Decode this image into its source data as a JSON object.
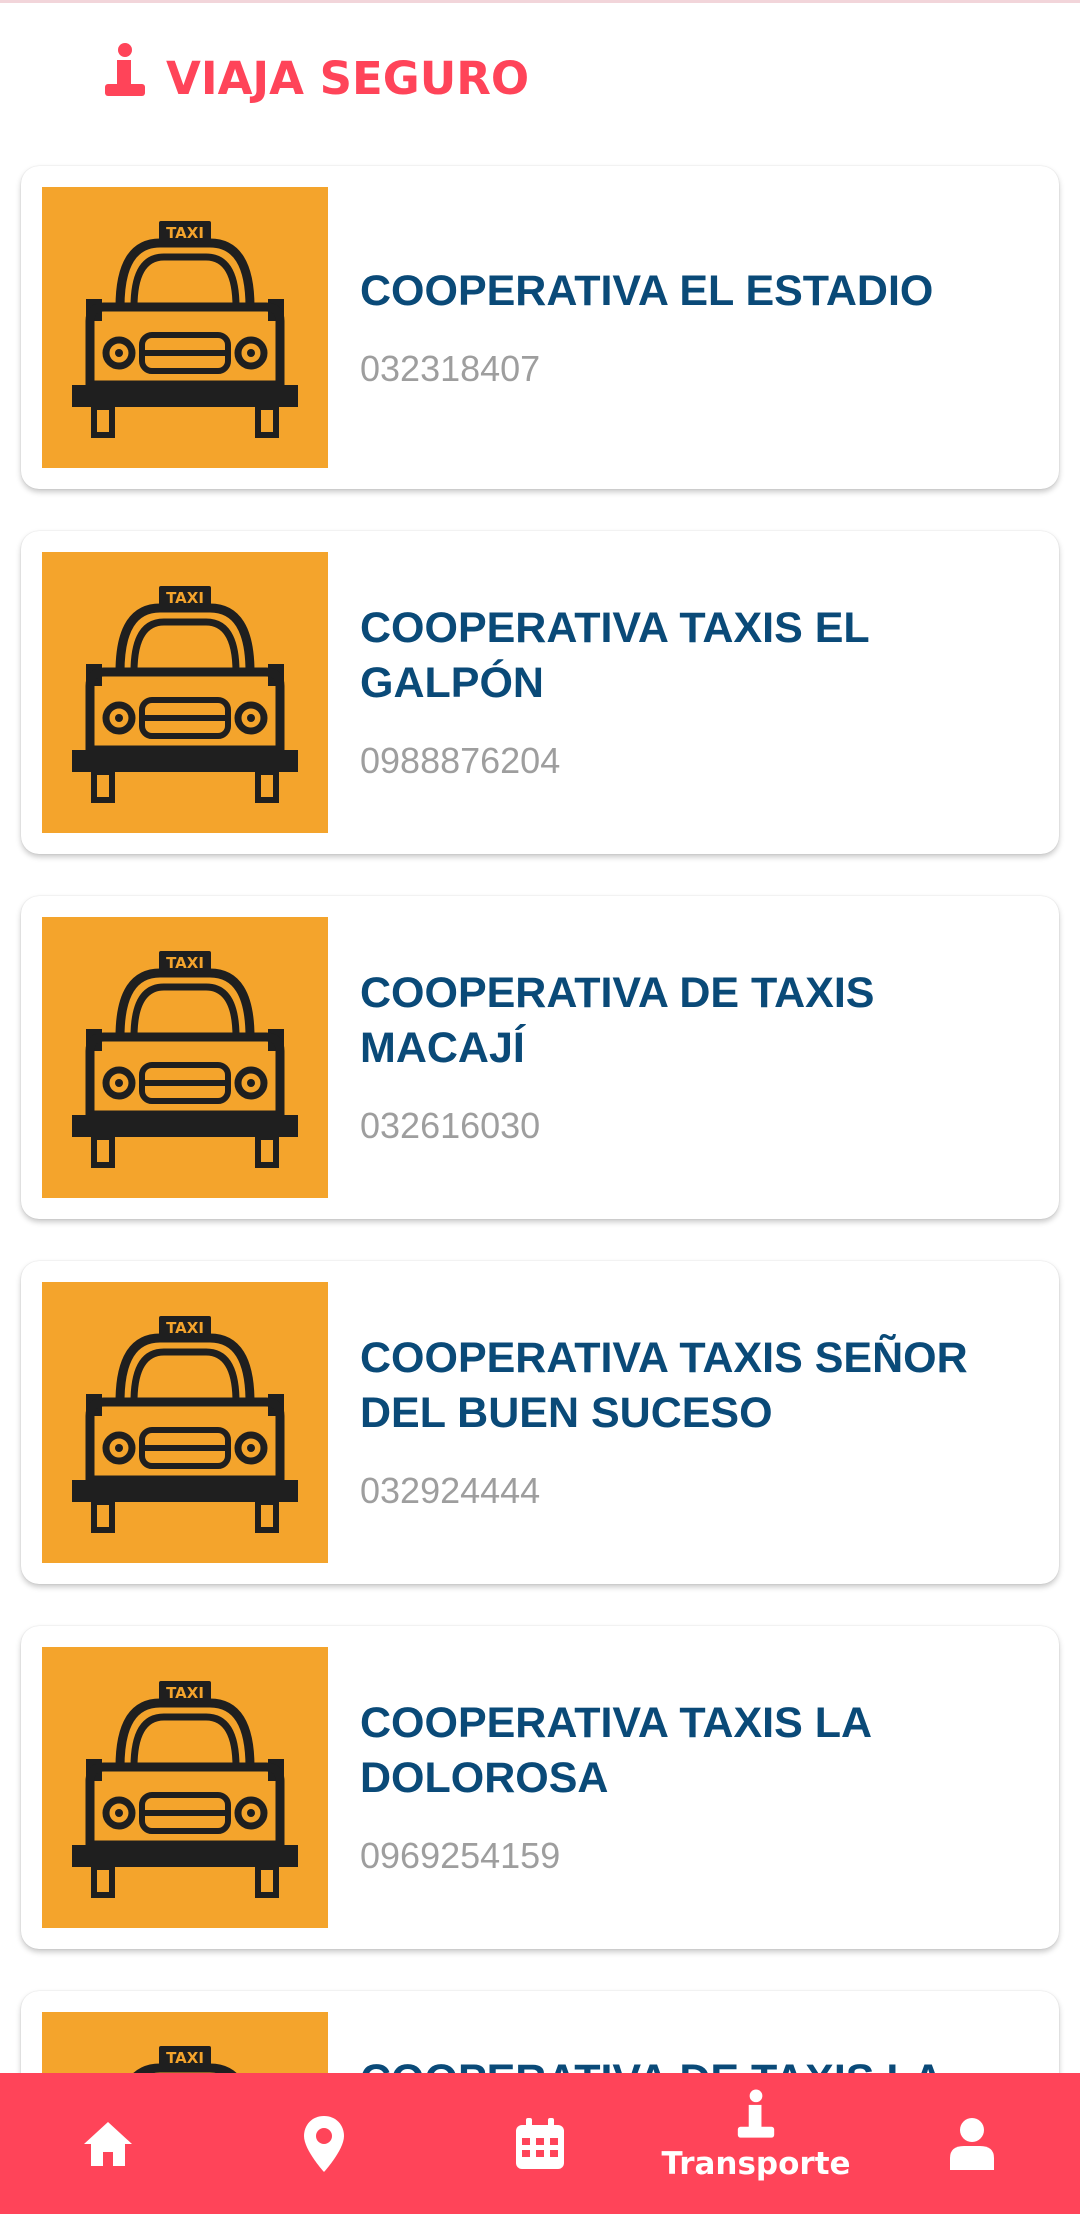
{
  "colors": {
    "accent": "#ff4459",
    "title_blue": "#0a4a78",
    "phone_gray": "#9e9e9e",
    "taxi_orange": "#f4a42c",
    "taxi_ink": "#1f1f1f",
    "nav_bg": "#ff4459",
    "nav_fg": "#ffffff"
  },
  "header": {
    "icon": "info-icon",
    "title": "VIAJA SEGURO"
  },
  "taxi_sign": "TAXI",
  "cooperatives": [
    {
      "name": "COOPERATIVA EL ESTADIO",
      "phone": "032318407"
    },
    {
      "name": "COOPERATIVA TAXIS EL GALPÓN",
      "phone": "0988876204"
    },
    {
      "name": "COOPERATIVA DE TAXIS MACAJÍ",
      "phone": "032616030"
    },
    {
      "name": "COOPERATIVA TAXIS SEÑOR DEL BUEN SUCESO",
      "phone": "032924444"
    },
    {
      "name": "COOPERATIVA TAXIS LA DOLOROSA",
      "phone": "0969254159"
    },
    {
      "name": "COOPERATIVA DE TAXIS LA",
      "phone": ""
    }
  ],
  "bottom_nav": [
    {
      "icon": "home-icon",
      "label": ""
    },
    {
      "icon": "location-pin-icon",
      "label": ""
    },
    {
      "icon": "calendar-icon",
      "label": ""
    },
    {
      "icon": "info-icon",
      "label": "Transporte",
      "active": true
    },
    {
      "icon": "user-icon",
      "label": ""
    }
  ]
}
